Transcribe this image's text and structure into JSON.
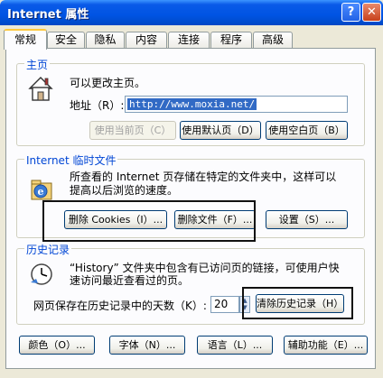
{
  "window": {
    "title": "Internet 属性"
  },
  "tabs": [
    "常规",
    "安全",
    "隐私",
    "内容",
    "连接",
    "程序",
    "高级"
  ],
  "homepage": {
    "label": "主页",
    "description": "可以更改主页。",
    "address_label": "地址（R）:",
    "address_value": "http://www.moxia.net/",
    "btn_current": "使用当前页（C）",
    "btn_default": "使用默认页（D）",
    "btn_blank": "使用空白页（B）"
  },
  "temp_files": {
    "label": "Internet 临时文件",
    "description_line1": "所查看的 Internet 页存储在特定的文件夹中，这样可以",
    "description_line2": "提高以后浏览的速度。",
    "btn_delete_cookies": "删除 Cookies（I）...",
    "btn_delete_files": "删除文件（F）...",
    "btn_settings": "设置（S）..."
  },
  "history": {
    "label": "历史记录",
    "description_line1": "“History” 文件夹中包含有已访问页的链接，可使用户快",
    "description_line2": "速访问最近查看过的页。",
    "days_label": "网页保存在历史记录中的天数（K）:",
    "days_value": "20",
    "btn_clear": "清除历史记录（H）"
  },
  "bottom_buttons": {
    "colors": "颜色（O）...",
    "fonts": "字体（N）...",
    "languages": "语言（L）...",
    "accessibility": "辅助功能（E）..."
  }
}
